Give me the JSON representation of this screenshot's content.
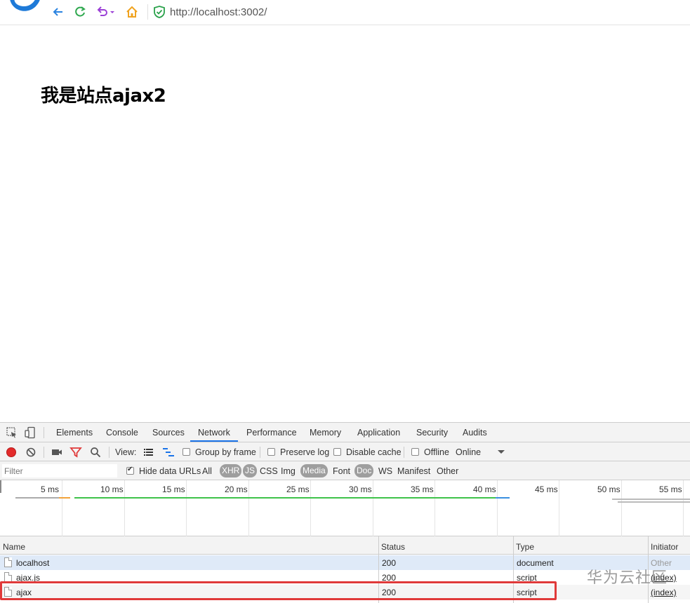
{
  "browser": {
    "url": "http://localhost:3002/"
  },
  "page": {
    "heading": "我是站点ajax2"
  },
  "devtools": {
    "tabs": [
      {
        "label": "Elements"
      },
      {
        "label": "Console"
      },
      {
        "label": "Sources"
      },
      {
        "label": "Network",
        "active": true
      },
      {
        "label": "Performance"
      },
      {
        "label": "Memory"
      },
      {
        "label": "Application"
      },
      {
        "label": "Security"
      },
      {
        "label": "Audits"
      }
    ],
    "toolbar": {
      "view_label": "View:",
      "group_by_frame": "Group by frame",
      "preserve_log": "Preserve log",
      "disable_cache": "Disable cache",
      "offline": "Offline",
      "throttle": "Online"
    },
    "filter": {
      "placeholder": "Filter",
      "hide_data_urls": "Hide data URLs",
      "types": [
        "All",
        "XHR",
        "JS",
        "CSS",
        "Img",
        "Media",
        "Font",
        "Doc",
        "WS",
        "Manifest",
        "Other"
      ]
    },
    "timeline": {
      "ticks": [
        "5 ms",
        "10 ms",
        "15 ms",
        "20 ms",
        "25 ms",
        "30 ms",
        "35 ms",
        "40 ms",
        "45 ms",
        "50 ms",
        "55 ms"
      ]
    },
    "table": {
      "headers": [
        "Name",
        "Status",
        "Type",
        "Initiator"
      ],
      "rows": [
        {
          "name": "localhost",
          "status": "200",
          "type": "document",
          "initiator": "Other"
        },
        {
          "name": "ajax.js",
          "status": "200",
          "type": "script",
          "initiator": "(index)"
        },
        {
          "name": "ajax",
          "status": "200",
          "type": "script",
          "initiator": "(index)"
        }
      ]
    }
  },
  "watermark": "华为云社区"
}
